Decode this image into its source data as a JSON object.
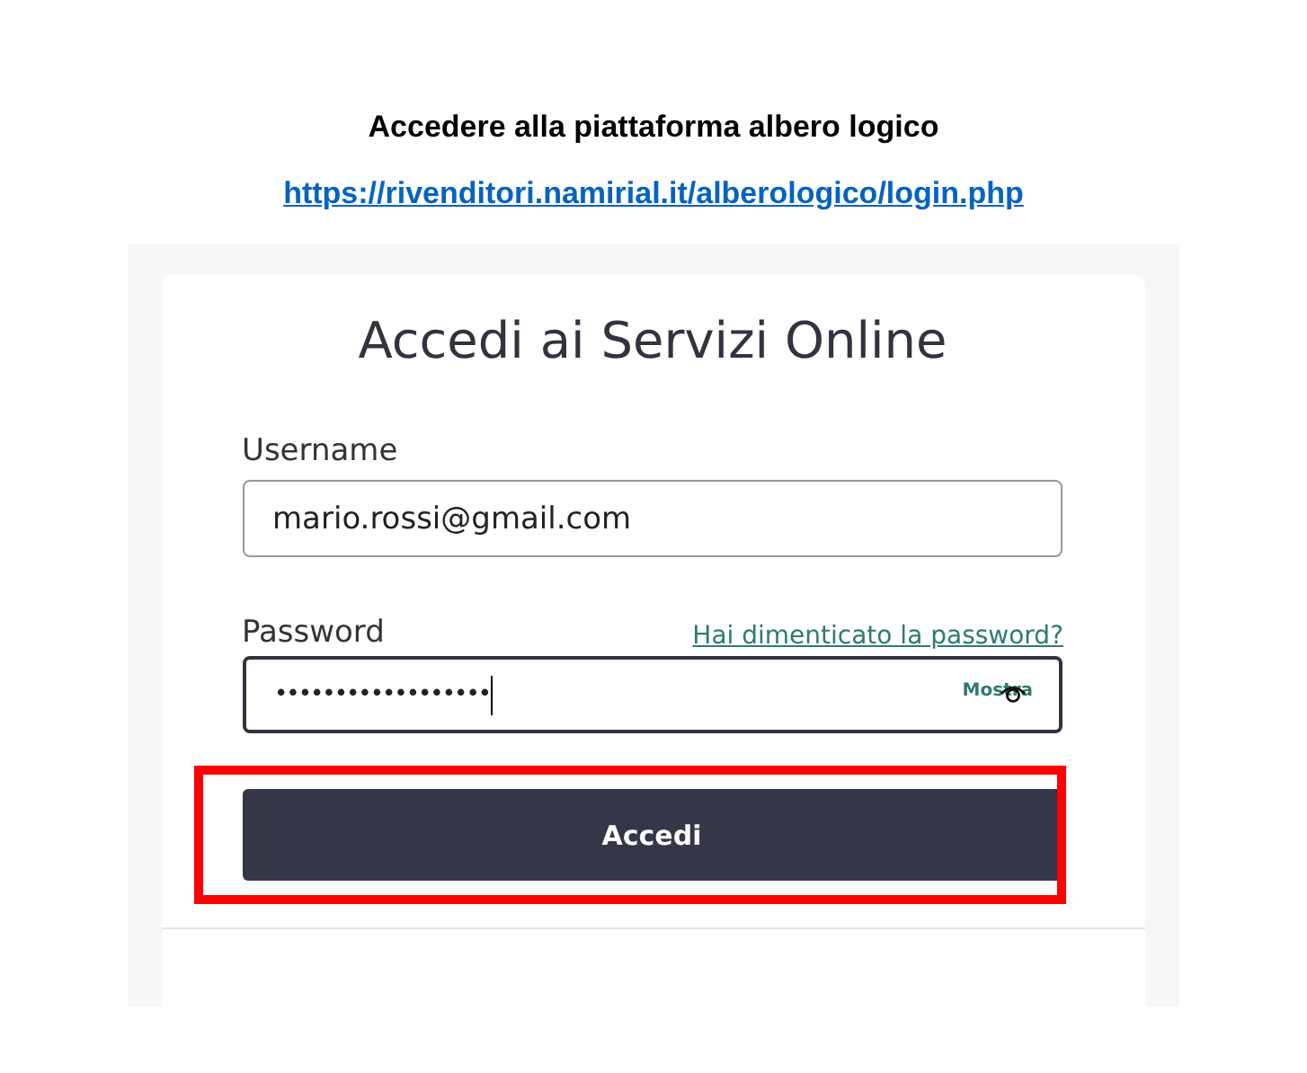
{
  "heading": "Accedere alla piattaforma albero logico",
  "url_link": "https://rivenditori.namirial.it/alberologico/login.php",
  "login_card": {
    "title": "Accedi ai Servizi Online",
    "username": {
      "label": "Username",
      "value": "mario.rossi@gmail.com"
    },
    "password": {
      "label": "Password",
      "forgot_link": "Hai dimenticato la password?",
      "value": "••••••••••••••••••",
      "focused": true,
      "show_toggle": "Mostra"
    },
    "submit_button": "Accedi",
    "highlighted": true
  }
}
